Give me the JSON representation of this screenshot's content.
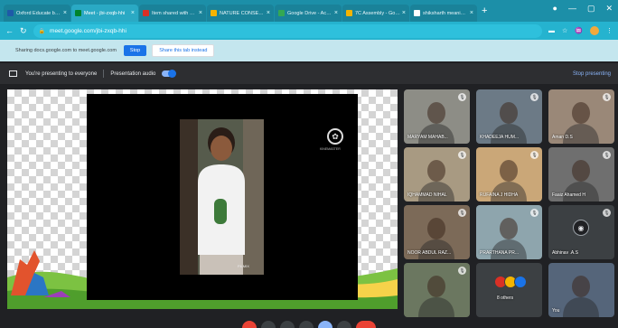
{
  "browser": {
    "tabs": [
      {
        "title": "Oxford Educate by O...",
        "favicon_color": "#1e5aa8",
        "active": false
      },
      {
        "title": "Meet - jbi-zxqb-hhi",
        "favicon_color": "#00832d",
        "active": true
      },
      {
        "title": "Item shared with you",
        "favicon_color": "#d93025",
        "active": false
      },
      {
        "title": "NATURE CONSER...",
        "favicon_color": "#f4b400",
        "active": false
      },
      {
        "title": "Google Drive - Accou...",
        "favicon_color": "#34a853",
        "active": false
      },
      {
        "title": "7C Assembly - Googl...",
        "favicon_color": "#f4b400",
        "active": false
      },
      {
        "title": "shiksharth meaning ...",
        "favicon_color": "#ffffff",
        "active": false
      }
    ],
    "new_tab": "+",
    "window_controls": [
      "●",
      "—",
      "▢",
      "✕"
    ],
    "url": "meet.google.com/jbi-zxqb-hhi"
  },
  "share_bar": {
    "message": "Sharing docs.google.com to meet.google.com",
    "stop_label": "Stop",
    "share_tab_label": "Share this tab instead"
  },
  "presenting_bar": {
    "message": "You're presenting to everyone",
    "audio_label": "Presentation audio",
    "stop_label": "Stop presenting"
  },
  "presentation": {
    "watermark_label": "KINEMASTER",
    "video_label": "FILMIX"
  },
  "participants": [
    {
      "name": "MARYAM MAHAB...",
      "bg": "#8d8d86"
    },
    {
      "name": "KHADEEJA HUM...",
      "bg": "#6c7a86"
    },
    {
      "name": "Aman D.S",
      "bg": "#9a8878"
    },
    {
      "name": "IQHAMMAD NIHAL",
      "bg": "#a89a82"
    },
    {
      "name": "RUFAINA J HIDHA",
      "bg": "#caa778"
    },
    {
      "name": "Faaiz Ahamed H",
      "bg": "#6f6f6f"
    },
    {
      "name": "NOOR ABDUL RAZ...",
      "bg": "#7c6a58"
    },
    {
      "name": "PRARTHANA PR...",
      "bg": "#8ea5ad"
    },
    {
      "name": "Abhinav .A.S",
      "bg": "#3c4043"
    },
    {
      "name": "",
      "bg": "#6b7760"
    },
    {
      "name": "8 others",
      "bg": "#3c4043"
    },
    {
      "name": "You",
      "bg": "#55657a"
    }
  ]
}
